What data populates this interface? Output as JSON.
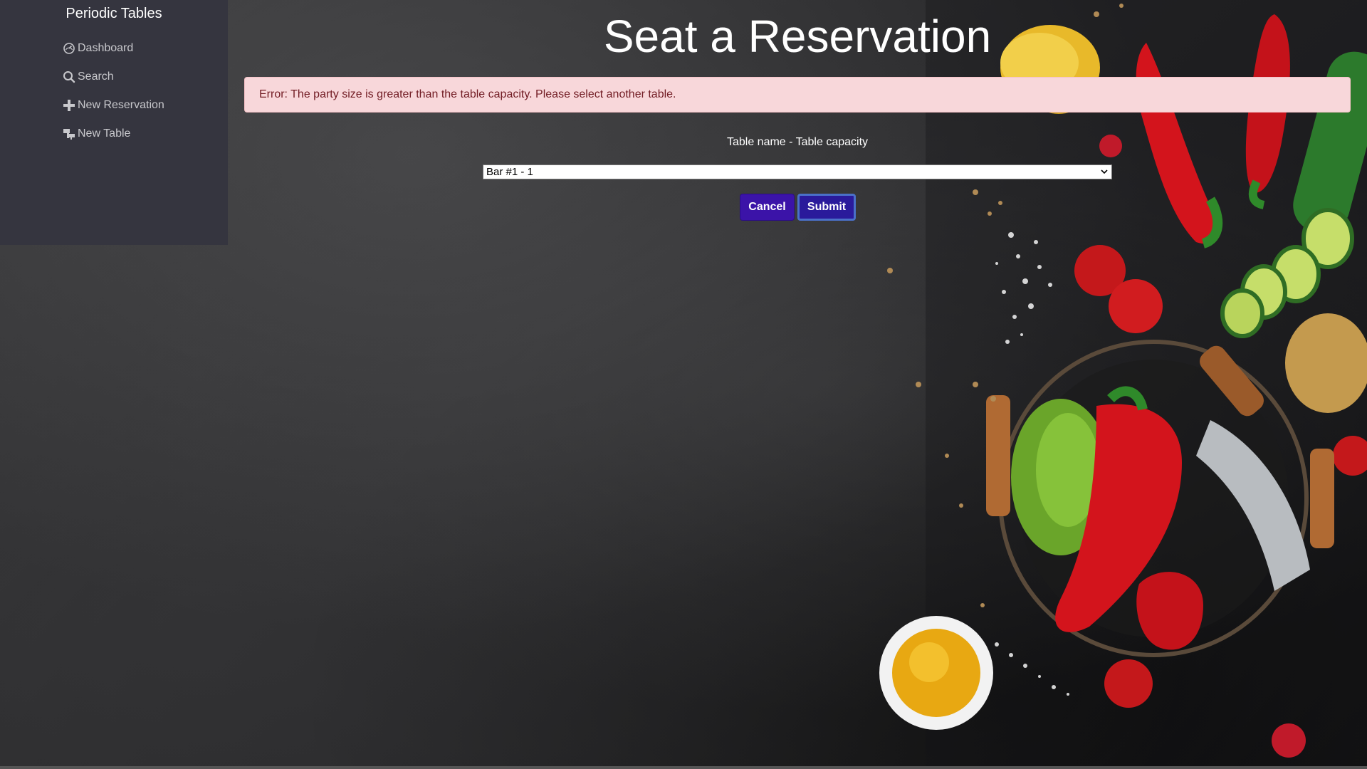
{
  "sidebar": {
    "brand": "Periodic Tables",
    "items": [
      {
        "label": "Dashboard",
        "icon": "dashboard-icon"
      },
      {
        "label": "Search",
        "icon": "search-icon"
      },
      {
        "label": "New Reservation",
        "icon": "plus-icon"
      },
      {
        "label": "New Table",
        "icon": "table-icon"
      }
    ]
  },
  "main": {
    "title": "Seat a Reservation",
    "error": "Error: The party size is greater than the table capacity. Please select another table.",
    "form": {
      "label": "Table name - Table capacity",
      "selected": "Bar #1 - 1",
      "cancel_label": "Cancel",
      "submit_label": "Submit"
    }
  },
  "colors": {
    "sidebar_bg": "#35353f",
    "alert_bg": "#f8d7da",
    "alert_text": "#721c24",
    "button_bg": "#3b13a8"
  }
}
